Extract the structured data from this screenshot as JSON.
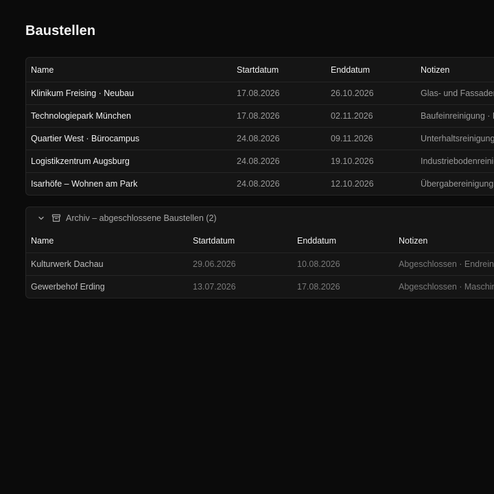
{
  "page": {
    "title": "Baustellen"
  },
  "active_table": {
    "columns": [
      "Name",
      "Startdatum",
      "Enddatum",
      "Notizen"
    ],
    "rows": [
      {
        "name": "Klinikum Freising · Neubau",
        "start": "17.08.2026",
        "end": "26.10.2026",
        "notes": "Glas- und Fassadenreinigung"
      },
      {
        "name": "Technologiepark München",
        "start": "17.08.2026",
        "end": "02.11.2026",
        "notes": "Baufeinreinigung · Hallen"
      },
      {
        "name": "Quartier West · Bürocampus",
        "start": "24.08.2026",
        "end": "09.11.2026",
        "notes": "Unterhaltsreinigung Büros"
      },
      {
        "name": "Logistikzentrum Augsburg",
        "start": "24.08.2026",
        "end": "19.10.2026",
        "notes": "Industriebodenreinigung"
      },
      {
        "name": "Isarhöfe – Wohnen am Park",
        "start": "24.08.2026",
        "end": "12.10.2026",
        "notes": "Übergabereinigung Wohnungen"
      }
    ]
  },
  "archive": {
    "label": "Archiv – abgeschlossene Baustellen (2)",
    "chevron_icon": "chevron-down-icon",
    "box_icon": "archive-box-icon",
    "columns": [
      "Name",
      "Startdatum",
      "Enddatum",
      "Notizen"
    ],
    "rows": [
      {
        "name": "Kulturwerk Dachau",
        "start": "29.06.2026",
        "end": "10.08.2026",
        "notes": "Abgeschlossen · Endreinigung"
      },
      {
        "name": "Gewerbehof Erding",
        "start": "13.07.2026",
        "end": "17.08.2026",
        "notes": "Abgeschlossen · Maschinenreinigung"
      }
    ]
  }
}
